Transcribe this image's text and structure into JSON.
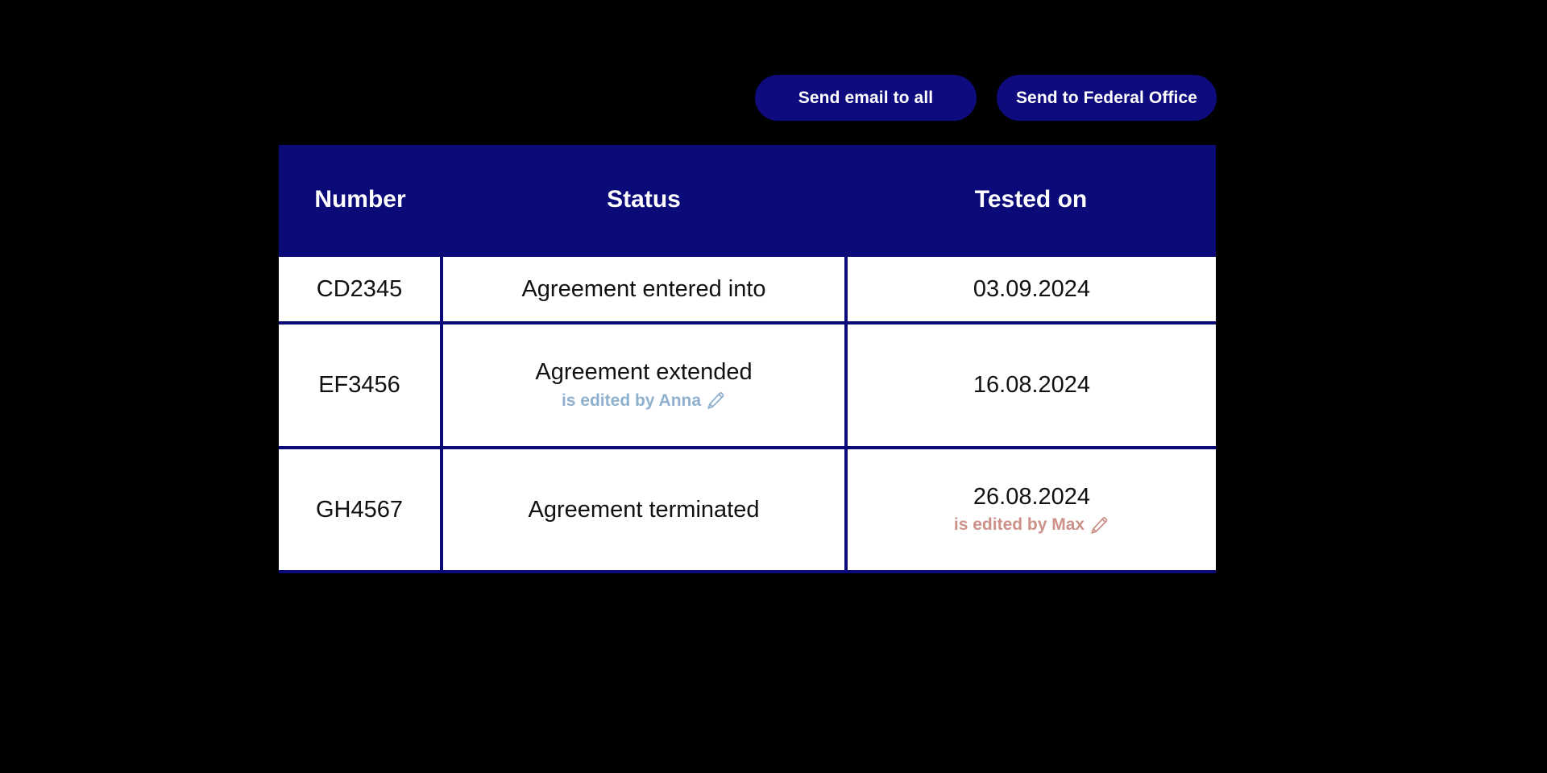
{
  "toolbar": {
    "buttons": [
      {
        "label": "Send email to all",
        "name": "send-email-to-all-button"
      },
      {
        "label": "Send to Federal Office",
        "name": "send-to-federal-office-button"
      }
    ]
  },
  "table": {
    "headers": {
      "number": "Number",
      "status": "Status",
      "tested_on": "Tested on"
    },
    "rows": [
      {
        "number": "CD2345",
        "status": "Agreement entered into",
        "status_edit_note": "",
        "tested_on": "03.09.2024",
        "tested_on_edit_note": ""
      },
      {
        "number": "EF3456",
        "status": "Agreement extended",
        "status_edit_note": "is edited by Anna",
        "tested_on": "16.08.2024",
        "tested_on_edit_note": ""
      },
      {
        "number": "GH4567",
        "status": "Agreement terminated",
        "status_edit_note": "",
        "tested_on": "26.08.2024",
        "tested_on_edit_note": "is edited by Max"
      }
    ]
  },
  "icons": {
    "edit_pencil": "pencil-icon"
  },
  "colors": {
    "navy": "#0a0a78",
    "button_navy": "#0d0b7d",
    "background": "#000000",
    "cell_background": "#ffffff",
    "edited_blue": "#8fb0ce",
    "edited_salmon": "#cc9189",
    "header_text": "#ffffff",
    "cell_text": "#111111"
  }
}
